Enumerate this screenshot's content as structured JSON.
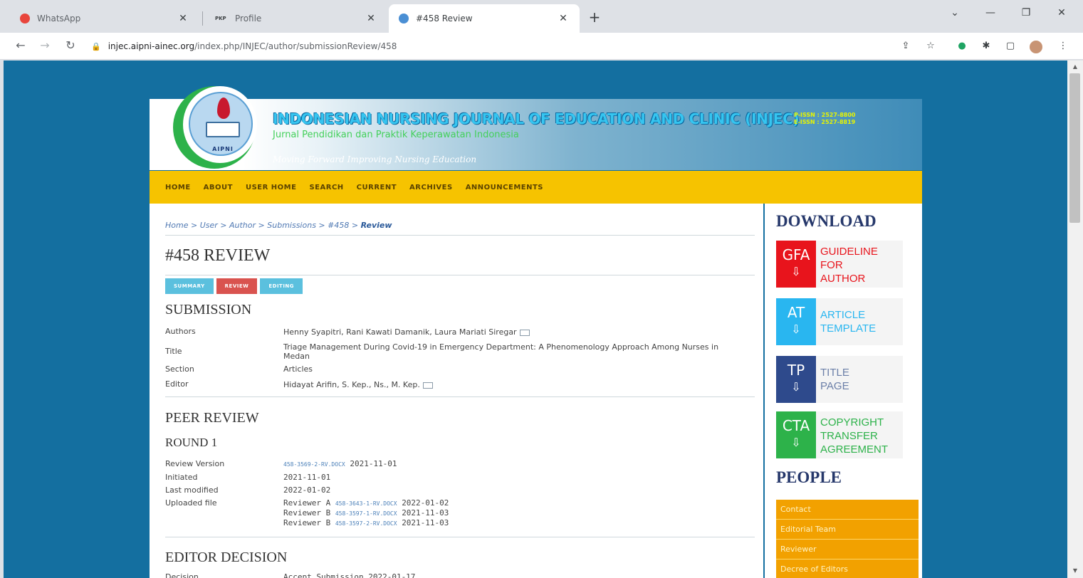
{
  "browser": {
    "tabs": [
      {
        "label": "WhatsApp",
        "favicon_color": "#e8453c"
      },
      {
        "label": "Profile",
        "favicon_text": "PKP"
      },
      {
        "label": "#458 Review",
        "favicon_color": "#4a8fd4"
      }
    ],
    "url_host": "injec.aipni-ainec.org",
    "url_path": "/index.php/INJEC/author/submissionReview/458"
  },
  "journal": {
    "title": "INDONESIAN NURSING JOURNAL OF EDUCATION AND CLINIC (INJEC)",
    "issn_print": "P-ISSN : 2527-8800",
    "issn_online": "E-ISSN : 2527-8819",
    "subtitle": "Jurnal Pendidikan dan Praktik Keperawatan Indonesia",
    "motto": "Moving Forward Improving Nursing Education",
    "logo_text": "AIPNI"
  },
  "nav": [
    "HOME",
    "ABOUT",
    "USER HOME",
    "SEARCH",
    "CURRENT",
    "ARCHIVES",
    "ANNOUNCEMENTS"
  ],
  "breadcrumb": {
    "items": [
      "Home",
      "User",
      "Author",
      "Submissions",
      "#458"
    ],
    "current": "Review",
    "sep": " > "
  },
  "page": {
    "title": "#458 REVIEW",
    "subtabs": [
      {
        "label": "SUMMARY",
        "color": "#5bc0de"
      },
      {
        "label": "REVIEW",
        "color": "#d9534f"
      },
      {
        "label": "EDITING",
        "color": "#5bc0de"
      }
    ]
  },
  "submission": {
    "heading": "SUBMISSION",
    "labels": {
      "authors": "Authors",
      "title": "Title",
      "section": "Section",
      "editor": "Editor"
    },
    "authors": "Henny Syapitri, Rani Kawati Damanik, Laura Mariati Siregar",
    "title": "Triage Management During Covid-19 in Emergency Department: A Phenomenology Approach Among Nurses in Medan",
    "section": "Articles",
    "editor": "Hidayat Arifin, S. Kep., Ns., M. Kep."
  },
  "peer_review": {
    "heading": "PEER REVIEW",
    "round": "ROUND 1",
    "labels": {
      "review_version": "Review Version",
      "initiated": "Initiated",
      "last_modified": "Last modified",
      "uploaded_file": "Uploaded file"
    },
    "review_version_file": "458-3569-2-RV.DOCX",
    "review_version_date": "2021-11-01",
    "initiated": "2021-11-01",
    "last_modified": "2022-01-02",
    "uploads": [
      {
        "reviewer": "Reviewer A",
        "file": "458-3643-1-RV.DOCX",
        "date": "2022-01-02"
      },
      {
        "reviewer": "Reviewer B",
        "file": "458-3597-1-RV.DOCX",
        "date": "2021-11-03"
      },
      {
        "reviewer": "Reviewer B",
        "file": "458-3597-2-RV.DOCX",
        "date": "2021-11-03"
      }
    ]
  },
  "editor_decision": {
    "heading": "EDITOR DECISION",
    "label": "Decision",
    "value": "Accept Submission 2022-01-17"
  },
  "sidebar": {
    "download_heading": "DOWNLOAD",
    "downloads": [
      {
        "badge": "GFA",
        "lines": [
          "GUIDELINE",
          "FOR",
          "AUTHOR"
        ],
        "badge_color": "#e8141c",
        "text_color": "#e8141c"
      },
      {
        "badge": "AT",
        "lines": [
          "ARTICLE",
          "TEMPLATE"
        ],
        "badge_color": "#29b6f0",
        "text_color": "#29b6f0"
      },
      {
        "badge": "TP",
        "lines": [
          "TITLE",
          "PAGE"
        ],
        "badge_color": "#2e4a8c",
        "text_color": "#6b7fa8"
      },
      {
        "badge": "CTA",
        "lines": [
          "COPYRIGHT",
          "TRANSFER",
          "AGREEMENT"
        ],
        "badge_color": "#2db24a",
        "text_color": "#2db24a"
      }
    ],
    "people_heading": "PEOPLE",
    "people": [
      "Contact",
      "Editorial Team",
      "Reviewer",
      "Decree of Editors"
    ]
  }
}
